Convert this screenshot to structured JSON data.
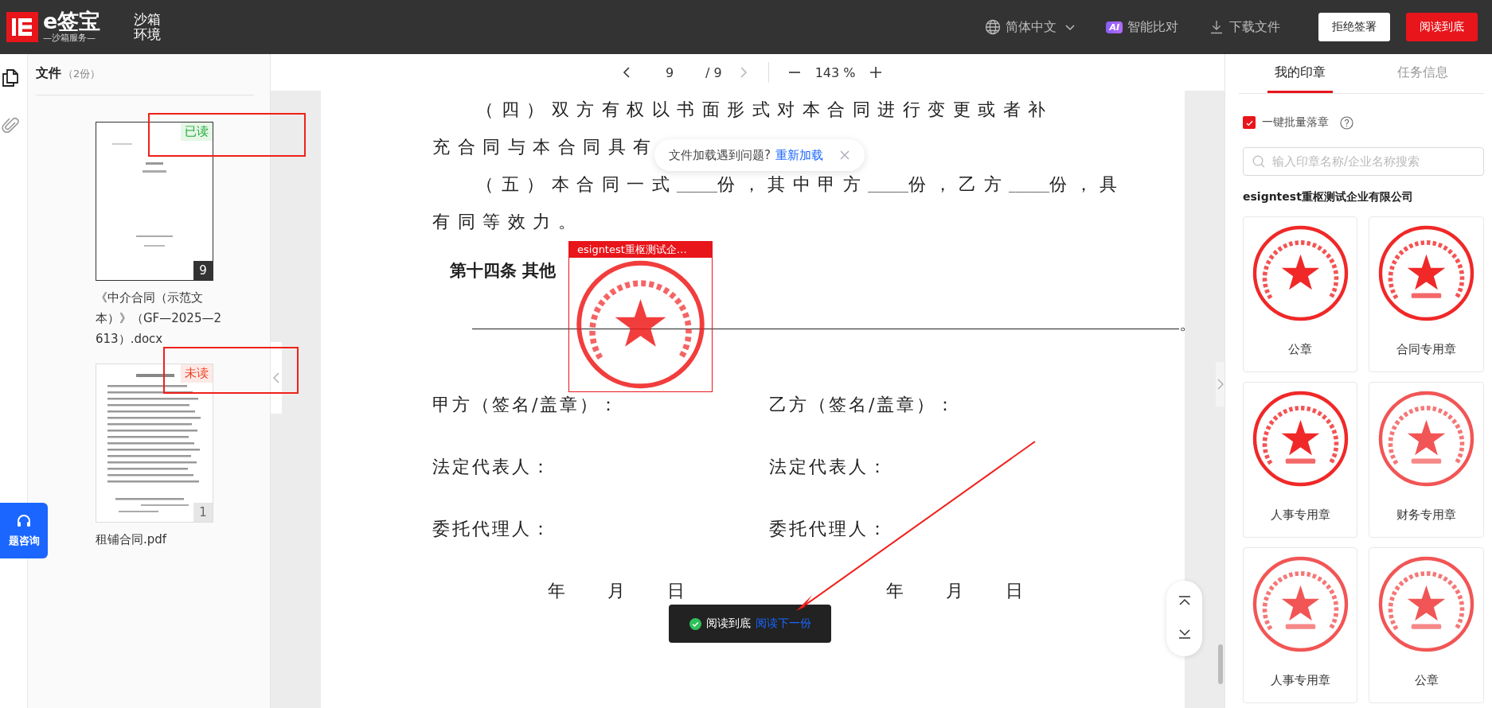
{
  "header": {
    "logo_text": "e签宝",
    "logo_subtitle": "—沙箱服务—",
    "environment": "沙箱环境",
    "language": "简体中文",
    "ai_badge": "AI",
    "ai_compare": "智能比对",
    "download": "下载文件",
    "buttons": [
      {
        "label": "拒绝签署",
        "kind": "secondary"
      },
      {
        "label": "阅读到底",
        "kind": "primary"
      }
    ]
  },
  "left_rail": {
    "items": [
      {
        "kind": "files",
        "selected": true
      },
      {
        "kind": "attachments",
        "selected": false
      }
    ],
    "help_button": "题咨询"
  },
  "file_panel": {
    "title": "文件",
    "count": "（2份）",
    "files": [
      {
        "name": "《中介合同（示范文本）》（GF—2025—2613）.docx",
        "pages": "9",
        "status": "已读",
        "read": true,
        "selected": true
      },
      {
        "name": "租铺合同.pdf",
        "pages": "1",
        "status": "未读",
        "read": false,
        "selected": false
      }
    ]
  },
  "toolbar": {
    "page": "9",
    "total": "/ 9",
    "zoom": "143 %"
  },
  "document": {
    "lines": [
      {
        "kind": "para",
        "text": "（四）双方有权以书面形式对本合同进行变更或者补",
        "indent": true
      },
      {
        "kind": "para",
        "text": "充合同与本合同具有",
        "indent": false
      },
      {
        "kind": "para",
        "text": "（五）本合同一式______份，其中甲方______份，乙方______份，具",
        "indent": true
      },
      {
        "kind": "para",
        "text": "有同等效力。",
        "indent": false
      },
      {
        "kind": "heading",
        "text": "第十四条  其他"
      },
      {
        "kind": "rule",
        "text": "。"
      },
      {
        "kind": "pair",
        "left": "甲方（签名/盖章）：",
        "right": "乙方（签名/盖章）："
      },
      {
        "kind": "pair",
        "left": "法定代表人：",
        "right": "法定代表人："
      },
      {
        "kind": "pair",
        "left": "委托代理人：",
        "right": "委托代理人："
      },
      {
        "kind": "date",
        "left": "年　　月　　日",
        "right": "年　　月　　日"
      }
    ]
  },
  "seal_overlay": {
    "label": "esigntest重枢测试企…"
  },
  "load_toast": {
    "message": "文件加载遇到问题?",
    "action": "重新加载"
  },
  "read_toast": {
    "message": "阅读到底",
    "action": "阅读下一份"
  },
  "right_panel": {
    "tabs": [
      {
        "label": "我的印章",
        "selected": true
      },
      {
        "label": "任务信息",
        "selected": false
      }
    ],
    "batch": {
      "label": "一键批量落章",
      "checked": true
    },
    "search": {
      "placeholder": "输入印章名称/企业名称搜索"
    },
    "company": "esigntest重枢测试企业有限公司",
    "seals": [
      {
        "name": "公章",
        "kind": "picture"
      },
      {
        "name": "合同专用章",
        "kind": "picture"
      },
      {
        "name": "人事专用章",
        "kind": "picture"
      },
      {
        "name": "财务专用章",
        "kind": "picture"
      },
      {
        "name": "人事专用章",
        "kind": "picture"
      },
      {
        "name": "公章",
        "kind": "picture"
      }
    ]
  }
}
